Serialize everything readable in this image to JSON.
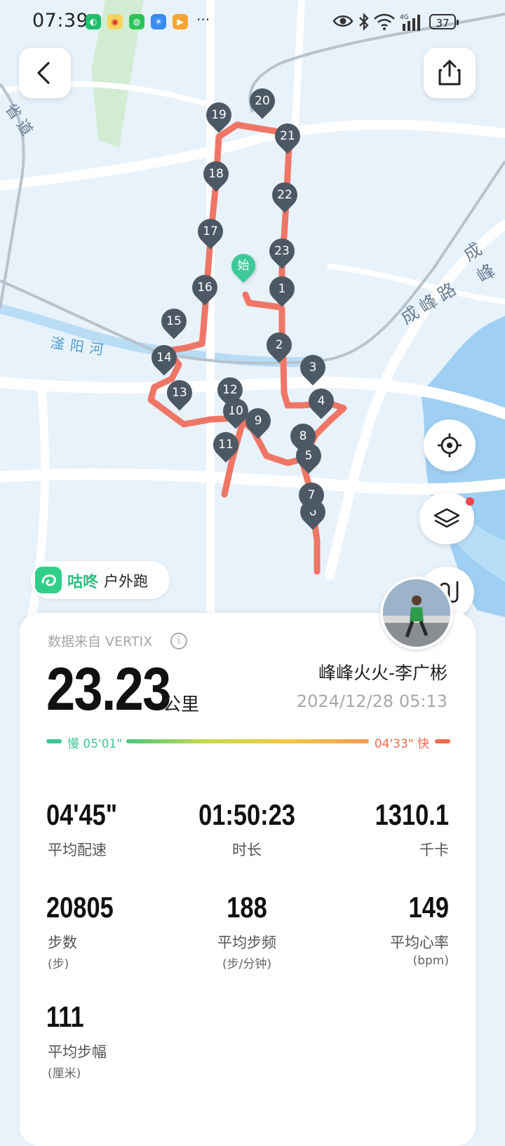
{
  "status_bar": {
    "time": "07:39",
    "apps": [
      "wechat-reading",
      "weibo",
      "wechat",
      "weather",
      "video"
    ],
    "more": "···",
    "battery": "37",
    "network": "4G"
  },
  "map": {
    "labels": {
      "road_chengfeng": "成峰路",
      "road_cheng": "成峰",
      "river": "滏阳河",
      "provincial_road": "省道"
    },
    "start_marker": "始",
    "km_markers": [
      "1",
      "2",
      "3",
      "4",
      "5",
      "6",
      "7",
      "8",
      "9",
      "10",
      "11",
      "12",
      "13",
      "14",
      "15",
      "16",
      "17",
      "18",
      "19",
      "20",
      "21",
      "22",
      "23"
    ],
    "route_color": "#ef7666"
  },
  "buttons": {
    "back": "back-icon",
    "share": "share-icon",
    "locate": "locate-icon",
    "layers": "layers-icon",
    "route": "route-icon"
  },
  "badge": {
    "brand": "咕咚",
    "activity_type": "户外跑"
  },
  "summary": {
    "source": "数据来自 VERTIX",
    "distance": "23.23",
    "distance_unit": "公里",
    "user_name": "峰峰火火-李广彬",
    "datetime": "2024/12/28 05:13",
    "pace_slow": "慢 05'01\"",
    "pace_fast": "04'33\" 快"
  },
  "stats": [
    {
      "value": "04'45\"",
      "label": "平均配速",
      "unit": ""
    },
    {
      "value": "01:50:23",
      "label": "时长",
      "unit": ""
    },
    {
      "value": "1310.1",
      "label": "千卡",
      "unit": ""
    },
    {
      "value": "20805",
      "label": "步数",
      "unit": "(步)"
    },
    {
      "value": "188",
      "label": "平均步频",
      "unit": "(步/分钟)"
    },
    {
      "value": "149",
      "label": "平均心率",
      "unit": "(bpm)"
    },
    {
      "value": "111",
      "label": "平均步幅",
      "unit": "(厘米)"
    }
  ],
  "colors": {
    "accent_green": "#2bbd7e",
    "pace_slow": "#3fc495",
    "pace_fast": "#f06a4c",
    "marker": "#4c5965"
  }
}
